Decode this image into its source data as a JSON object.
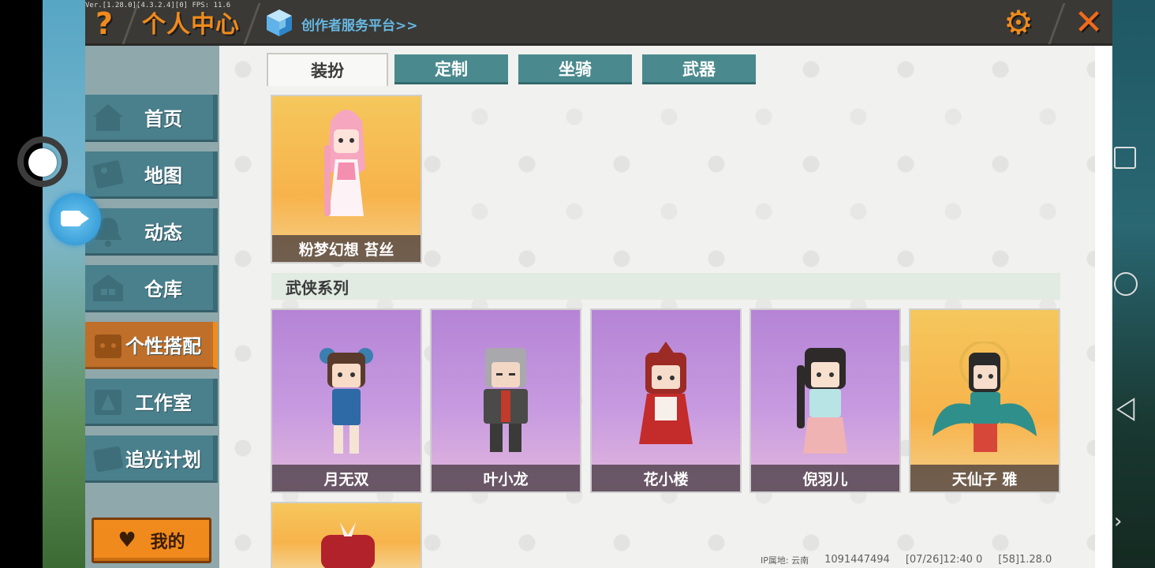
{
  "header": {
    "version": "Ver.[1.28.0][4.3.2.4][0] FPS: 11.6",
    "help": "?",
    "title": "个人中心",
    "creator_link": "创作者服务平台>>",
    "settings": "⚙",
    "close": "✕"
  },
  "sidebar": {
    "items": [
      {
        "label": "首页",
        "icon": "home-icon"
      },
      {
        "label": "地图",
        "icon": "map-icon"
      },
      {
        "label": "动态",
        "icon": "bell-icon"
      },
      {
        "label": "仓库",
        "icon": "warehouse-icon"
      },
      {
        "label": "个性搭配",
        "icon": "outfit-icon",
        "active": true
      },
      {
        "label": "工作室",
        "icon": "studio-icon"
      },
      {
        "label": "追光计划",
        "icon": "plan-icon"
      }
    ],
    "my_button": "我的"
  },
  "tabs": [
    {
      "label": "装扮",
      "active": true
    },
    {
      "label": "定制"
    },
    {
      "label": "坐骑"
    },
    {
      "label": "武器"
    }
  ],
  "featured": {
    "name": "粉梦幻想 苔丝",
    "theme": "gold"
  },
  "section": {
    "title": "武侠系列"
  },
  "cards": [
    {
      "name": "月无双",
      "theme": "purple"
    },
    {
      "name": "叶小龙",
      "theme": "purple"
    },
    {
      "name": "花小楼",
      "theme": "purple"
    },
    {
      "name": "倪羽儿",
      "theme": "purple"
    },
    {
      "name": "天仙子 雅",
      "theme": "gold"
    }
  ],
  "footer": {
    "ip": "IP属地: 云南",
    "uid": "1091447494",
    "time": "[07/26]12:40 0",
    "ver": "[58]1.28.0"
  },
  "colors": {
    "accent": "#f08a1c",
    "tab": "#4a8a8e",
    "sidebar_item": "#4a7f8c",
    "header_bg": "#3a3935"
  }
}
